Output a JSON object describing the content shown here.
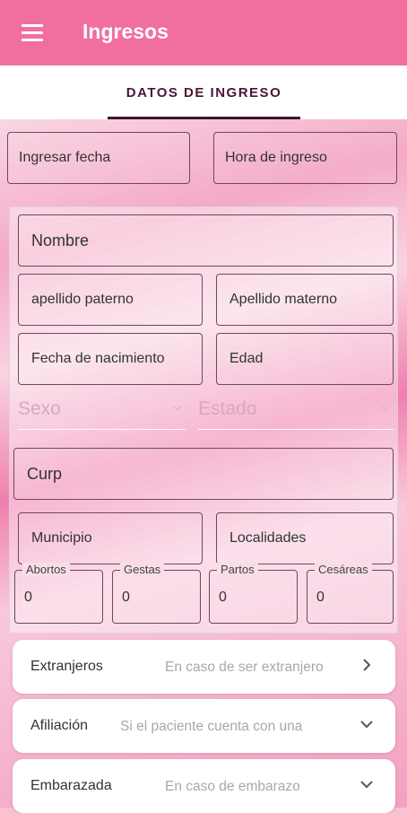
{
  "appbar": {
    "title": "Ingresos",
    "menu_icon": "menu-icon"
  },
  "tabs": [
    {
      "label": "DATOS DE INGRESO",
      "selected": true
    }
  ],
  "top_buttons": {
    "fecha": "Ingresar fecha",
    "hora": "Hora de ingreso"
  },
  "form": {
    "nombre": "Nombre",
    "apellido_paterno": "apellido paterno",
    "apellido_materno": "Apellido materno",
    "fecha_nacimiento": "Fecha de nacimiento",
    "edad": "Edad",
    "sexo": "Sexo",
    "estado": "Estado",
    "curp": "Curp",
    "municipio": "Municipio",
    "localidades": "Localidades",
    "counts": [
      {
        "label": "Abortos",
        "value": "0"
      },
      {
        "label": "Gestas",
        "value": "0"
      },
      {
        "label": "Partos",
        "value": "0"
      },
      {
        "label": "Cesáreas",
        "value": "0"
      }
    ]
  },
  "cards": [
    {
      "title": "Extranjeros",
      "subtitle": "En caso de ser extranjero",
      "icon": "chevron-right-icon"
    },
    {
      "title": "Afiliación",
      "subtitle": "Si el paciente cuenta con una",
      "icon": "chevron-down-icon"
    },
    {
      "title": "Embarazada",
      "subtitle": "En caso de embarazo",
      "icon": "chevron-down-icon"
    }
  ],
  "colors": {
    "appbar": "#f06f9f",
    "tab_text": "#4a1535",
    "outline": "#6b4a58"
  }
}
